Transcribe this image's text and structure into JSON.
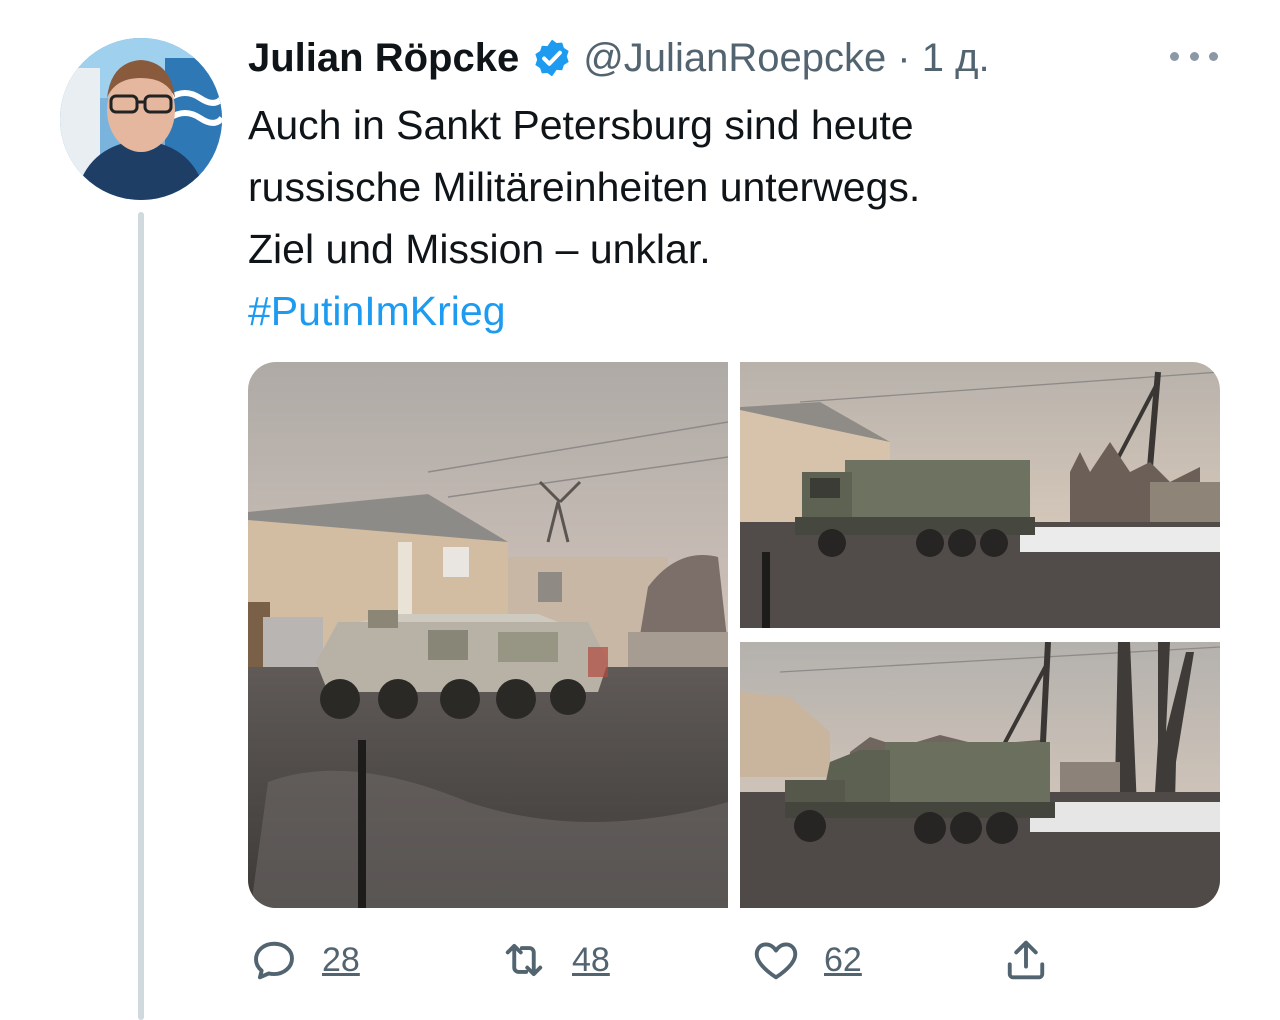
{
  "tweet": {
    "author_name": "Julian Röpcke",
    "handle_time": "@JulianRoepcke · 1 д.",
    "text_lines": [
      "Auch in Sankt Petersburg sind heute",
      "russische Militäreinheiten unterwegs.",
      "Ziel und Mission – unklar."
    ],
    "hashtag": "#PutinImKrieg"
  },
  "actions": {
    "reply_count": "28",
    "retweet_count": "48",
    "like_count": "62"
  },
  "icons": {
    "verified": "verified-badge-icon",
    "more": "more-icon",
    "reply": "reply-icon",
    "retweet": "retweet-icon",
    "like": "heart-icon",
    "share": "share-icon"
  },
  "colors": {
    "accent": "#1d9bf0",
    "secondary_text": "#536471",
    "thread_line": "#cfd9de"
  }
}
